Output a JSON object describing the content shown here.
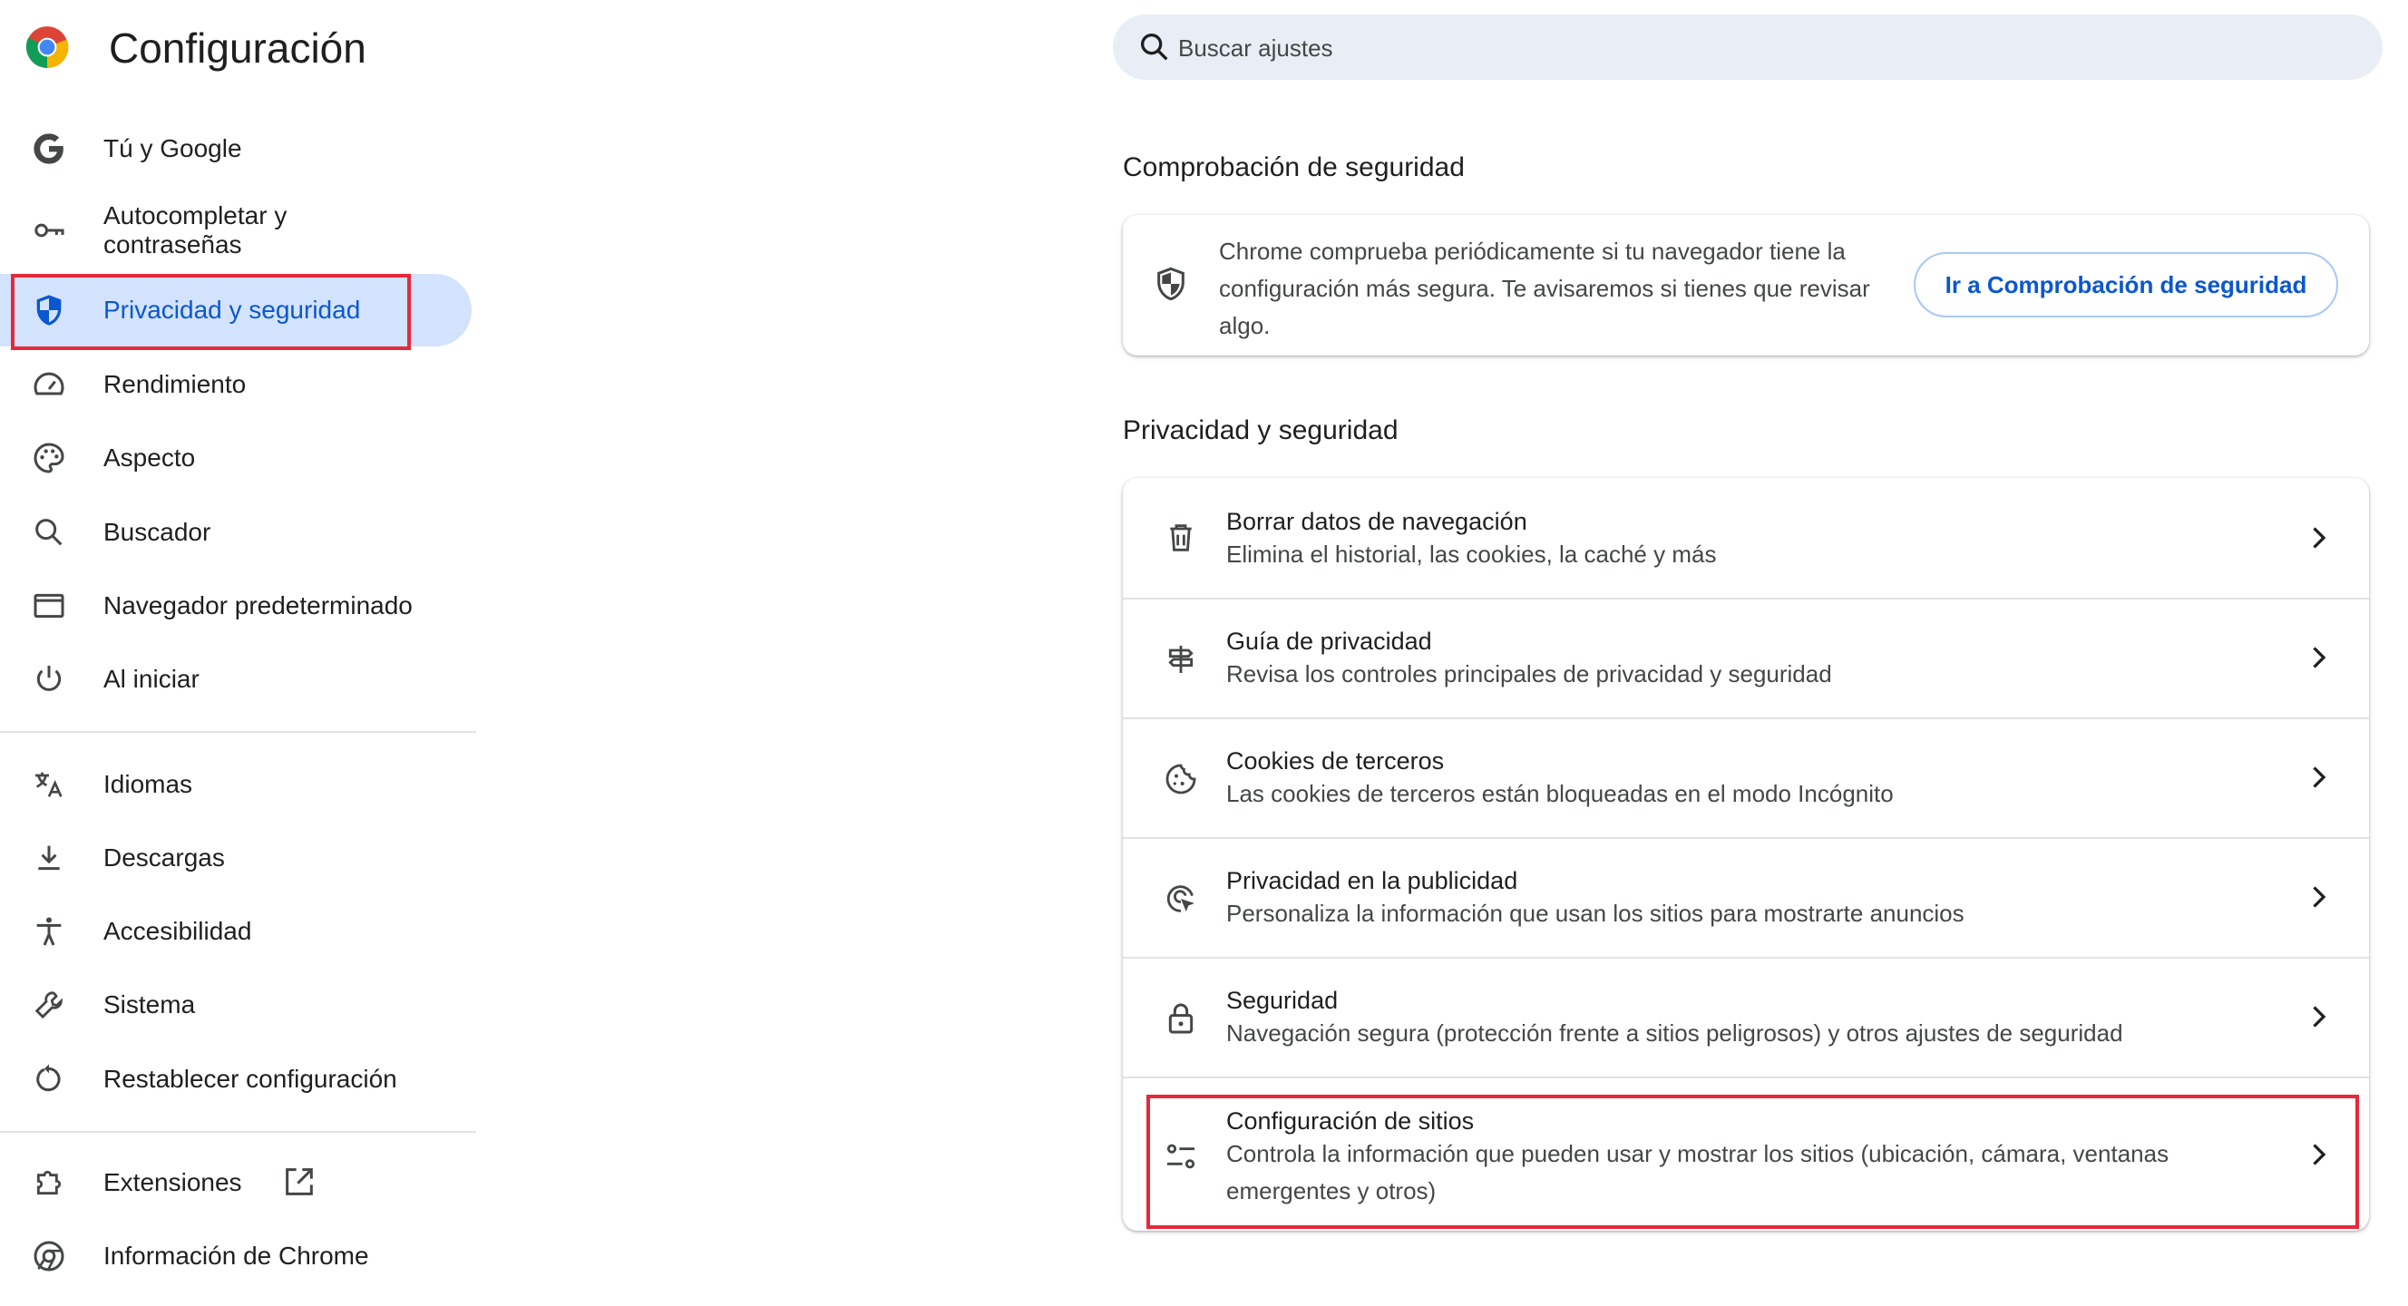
{
  "app": {
    "title": "Configuración",
    "colors": {
      "accent": "#0b57d0",
      "active_bg": "#d3e3fd",
      "highlight": "#e6293a",
      "search_bg": "#e9eef6"
    }
  },
  "search": {
    "placeholder": "Buscar ajustes",
    "value": ""
  },
  "sidebar": {
    "items": [
      {
        "label": "Tú y Google",
        "icon": "google-icon"
      },
      {
        "label": "Autocompletar y\ncontraseñas",
        "icon": "key-icon"
      },
      {
        "label": "Privacidad y seguridad",
        "icon": "shield-icon",
        "active": true
      },
      {
        "label": "Rendimiento",
        "icon": "speedometer-icon"
      },
      {
        "label": "Aspecto",
        "icon": "palette-icon"
      },
      {
        "label": "Buscador",
        "icon": "search-icon"
      },
      {
        "label": "Navegador predeterminado",
        "icon": "browser-window-icon"
      },
      {
        "label": "Al iniciar",
        "icon": "power-icon"
      },
      {
        "label": "Idiomas",
        "icon": "translate-icon"
      },
      {
        "label": "Descargas",
        "icon": "download-icon"
      },
      {
        "label": "Accesibilidad",
        "icon": "accessibility-icon"
      },
      {
        "label": "Sistema",
        "icon": "wrench-icon"
      },
      {
        "label": "Restablecer configuración",
        "icon": "restore-icon"
      },
      {
        "label": "Extensiones",
        "icon": "puzzle-icon",
        "trailing_icon": "open-in-new-icon"
      },
      {
        "label": "Información de Chrome",
        "icon": "chrome-icon"
      }
    ]
  },
  "safety_check": {
    "section_title": "Comprobación de seguridad",
    "description": "Chrome comprueba periódicamente si tu navegador tiene la configuración más segura. Te avisaremos si tienes que revisar algo.",
    "button_label": "Ir a Comprobación de seguridad"
  },
  "privacy": {
    "section_title": "Privacidad y seguridad",
    "rows": [
      {
        "title": "Borrar datos de navegación",
        "description": "Elimina el historial, las cookies, la caché y más",
        "icon": "trash-icon"
      },
      {
        "title": "Guía de privacidad",
        "description": "Revisa los controles principales de privacidad y seguridad",
        "icon": "signpost-icon"
      },
      {
        "title": "Cookies de terceros",
        "description": "Las cookies de terceros están bloqueadas en el modo Incógnito",
        "icon": "cookie-icon"
      },
      {
        "title": "Privacidad en la publicidad",
        "description": "Personaliza la información que usan los sitios para mostrarte anuncios",
        "icon": "ad-privacy-icon"
      },
      {
        "title": "Seguridad",
        "description": "Navegación segura (protección frente a sitios peligrosos) y otros ajustes de seguridad",
        "icon": "lock-icon"
      },
      {
        "title": "Configuración de sitios",
        "description": "Controla la información que pueden usar y mostrar los sitios (ubicación, cámara, ventanas emergentes y otros)",
        "icon": "tune-icon"
      }
    ]
  }
}
